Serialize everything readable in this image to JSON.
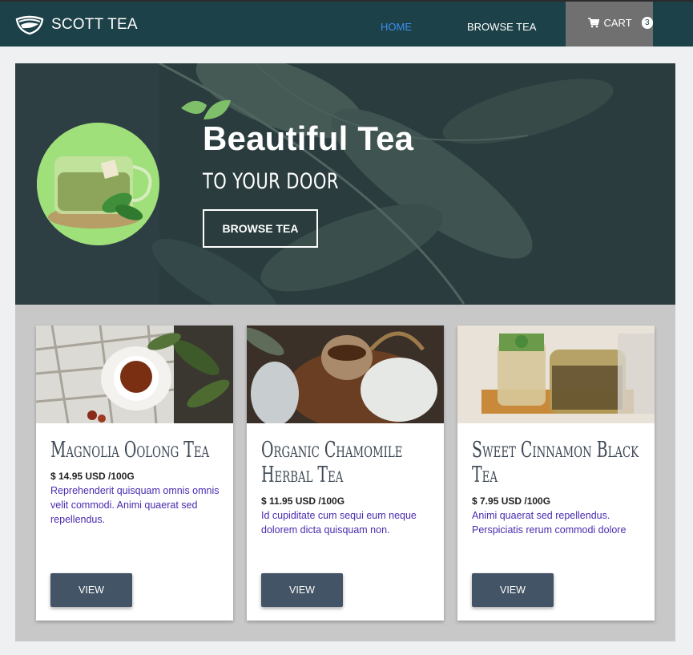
{
  "nav": {
    "brand": "SCOTT TEA",
    "home_label": "HOME",
    "browse_label": "BROWSE TEA",
    "cart_label": "CART",
    "cart_count": "3",
    "active": "HOME",
    "colors": {
      "bar": "#1c4148",
      "active_link": "#3b8ff0",
      "cart_bg": "#707070"
    }
  },
  "hero": {
    "title": "Beautiful Tea",
    "subtitle": "TO YOUR DOOR",
    "button_label": "BROWSE TEA"
  },
  "products": [
    {
      "name": "Magnolia Oolong Tea",
      "price": "$ 14.95 USD  /100G",
      "description": "Reprehenderit quisquam omnis omnis velit commodi. Animi quaerat sed repellendus.",
      "button_label": "VIEW"
    },
    {
      "name": "Organic Chamomile Herbal Tea",
      "price": "$ 11.95 USD  /100G",
      "description": "Id cupiditate cum sequi eum neque dolorem dicta quisquam non.",
      "button_label": "VIEW"
    },
    {
      "name": "Sweet Cinnamon Black Tea",
      "price": "$ 7.95 USD  /100G",
      "description": "Animi quaerat sed repellendus. Perspiciatis rerum commodi dolore",
      "button_label": "VIEW"
    }
  ]
}
